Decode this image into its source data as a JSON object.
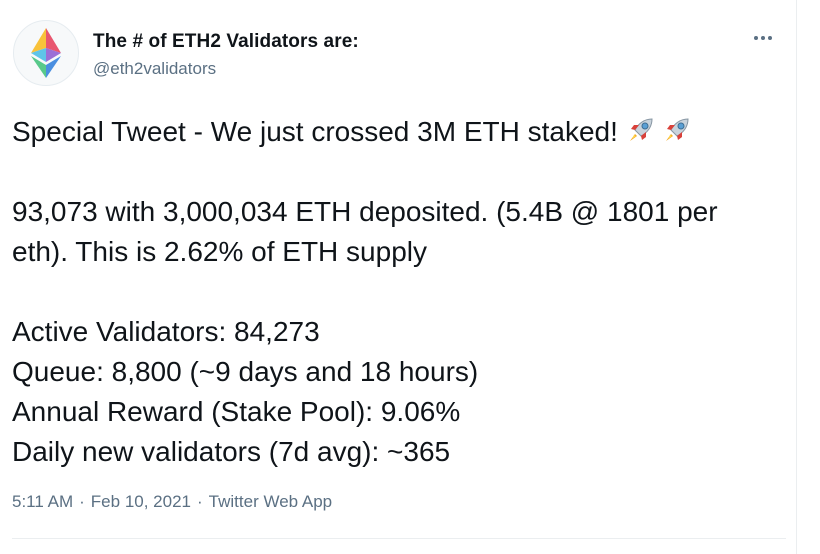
{
  "tweet": {
    "author": {
      "display_name": "The # of ETH2 Validators are:",
      "handle": "@eth2validators",
      "avatar_icon": "ethereum-logo-icon"
    },
    "more_icon": "more-options-icon",
    "lines": [
      "Special Tweet - We just crossed 3M ETH staked!",
      "93,073 with 3,000,034 ETH deposited. (5.4B @ 1801 per",
      "eth). This is 2.62% of ETH supply",
      "Active Validators: 84,273",
      "Queue: 8,800 (~9 days and 18 hours)",
      "Annual Reward (Stake Pool): 9.06%",
      "Daily new validators (7d avg): ~365"
    ],
    "emoji": [
      "rocket-icon",
      "rocket-icon"
    ],
    "time": "5:11 AM",
    "date": "Feb 10, 2021",
    "source": "Twitter Web App",
    "separator": "·"
  }
}
